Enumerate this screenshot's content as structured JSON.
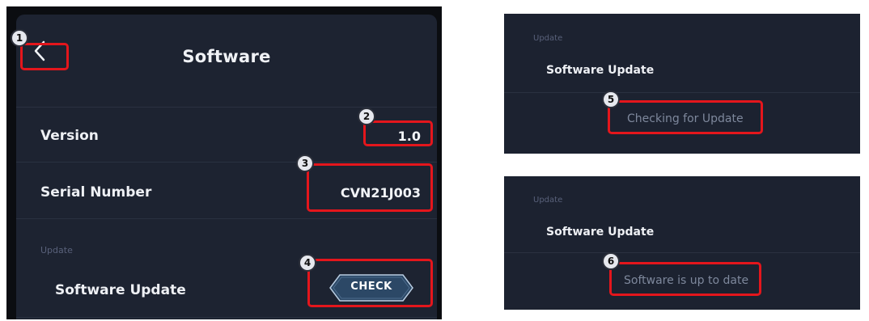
{
  "main": {
    "title": "Software",
    "back_icon": "chevron-left-icon",
    "version": {
      "label": "Version",
      "value": "1.0"
    },
    "serial": {
      "label": "Serial Number",
      "value": "CVN21J003"
    },
    "update_section": "Update",
    "software_update": {
      "label": "Software Update",
      "button": "CHECK"
    }
  },
  "panel_checking": {
    "section": "Update",
    "label": "Software Update",
    "status": "Checking for Update"
  },
  "panel_uptodate": {
    "section": "Update",
    "label": "Software Update",
    "status": "Software is up to date"
  },
  "callouts": [
    "1",
    "2",
    "3",
    "4",
    "5",
    "6"
  ],
  "colors": {
    "panel_bg": "#1d2331",
    "callout": "#e4161c",
    "text": "#eef0f4",
    "muted": "#59617a"
  }
}
